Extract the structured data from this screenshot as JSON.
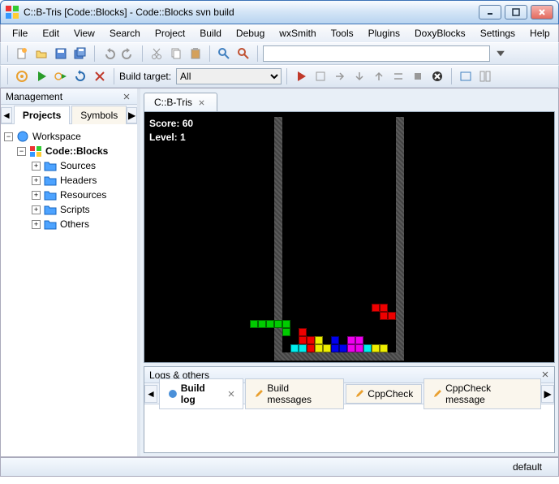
{
  "window": {
    "title": "C::B-Tris [Code::Blocks] - Code::Blocks svn build"
  },
  "menu": [
    "File",
    "Edit",
    "View",
    "Search",
    "Project",
    "Build",
    "Debug",
    "wxSmith",
    "Tools",
    "Plugins",
    "DoxyBlocks",
    "Settings",
    "Help"
  ],
  "toolbar2": {
    "build_target_label": "Build target:",
    "build_target_value": "All"
  },
  "management": {
    "title": "Management",
    "tabs": {
      "projects": "Projects",
      "symbols": "Symbols"
    },
    "tree": {
      "workspace": "Workspace",
      "project": "Code::Blocks",
      "folders": [
        "Sources",
        "Headers",
        "Resources",
        "Scripts",
        "Others"
      ]
    }
  },
  "editor": {
    "tab": "C::B-Tris",
    "game": {
      "score_label": "Score:",
      "score_value": "60",
      "level_label": "Level:",
      "level_value": "1"
    }
  },
  "logs": {
    "title": "Logs & others",
    "tabs": [
      "Build log",
      "Build messages",
      "CppCheck",
      "CppCheck message"
    ],
    "active": 0
  },
  "status": {
    "text": "default"
  }
}
